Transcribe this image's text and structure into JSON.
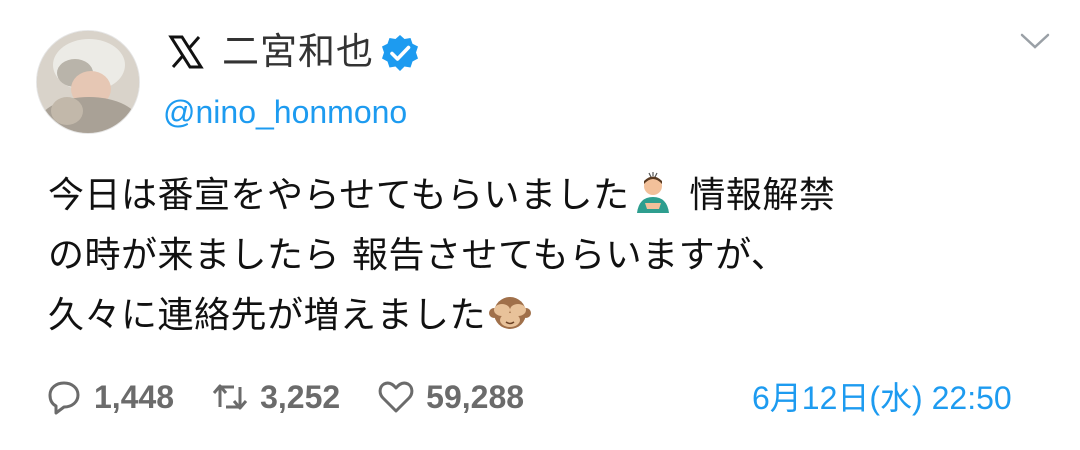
{
  "author": {
    "display_name": "二宮和也",
    "handle": "@nino_honmono",
    "verified": true,
    "platform_icon": "x-logo-icon"
  },
  "tweet": {
    "lines": [
      {
        "before": "今日は番宣をやらせてもらいました",
        "emoji": "person-bowing-emoji",
        "after": " 情報解禁"
      },
      {
        "before": "の時が来ましたら 報告させてもらいますが、",
        "emoji": "",
        "after": ""
      },
      {
        "before": "久々に連絡先が増えました",
        "emoji": "see-no-evil-monkey-emoji",
        "after": ""
      }
    ]
  },
  "stats": {
    "replies": "1,448",
    "retweets": "3,252",
    "likes": "59,288"
  },
  "timestamp": "6月12日(水) 22:50",
  "colors": {
    "accent": "#1d9bf0",
    "muted": "#6b6b6b",
    "text": "#111111"
  }
}
